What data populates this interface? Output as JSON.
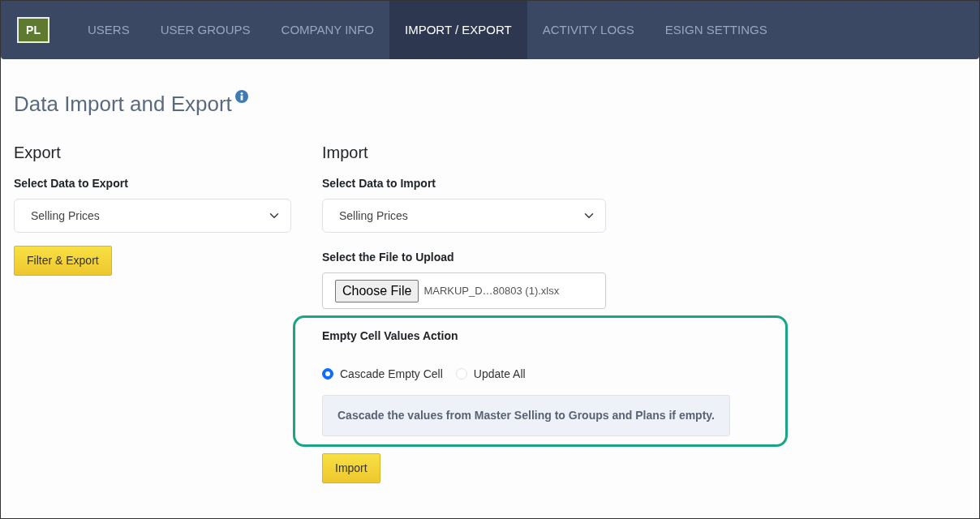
{
  "navbar": {
    "logo": "PL",
    "tabs": [
      {
        "label": "USERS",
        "selected": false
      },
      {
        "label": "USER GROUPS",
        "selected": false
      },
      {
        "label": "COMPANY INFO",
        "selected": false
      },
      {
        "label": "IMPORT / EXPORT",
        "selected": true
      },
      {
        "label": "ACTIVITY LOGS",
        "selected": false
      },
      {
        "label": "ESIGN SETTINGS",
        "selected": false
      }
    ]
  },
  "page_title": "Data Import and Export",
  "export": {
    "heading": "Export",
    "select_label": "Select Data to Export",
    "select_value": "Selling Prices",
    "button": "Filter & Export"
  },
  "import": {
    "heading": "Import",
    "select_label": "Select Data to Import",
    "select_value": "Selling Prices",
    "file_label": "Select the File to Upload",
    "file_button": "Choose File",
    "file_name": "MARKUP_D…80803 (1).xlsx",
    "empty_cell_action": {
      "label": "Empty Cell Values Action",
      "options": [
        {
          "label": "Cascade Empty Cell",
          "selected": true
        },
        {
          "label": "Update All",
          "selected": false
        }
      ],
      "help": "Cascade the values from Master Selling to Groups and Plans if empty."
    },
    "button": "Import"
  }
}
